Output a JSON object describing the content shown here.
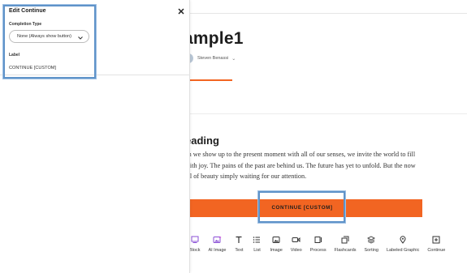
{
  "lesson": {
    "title": "ample1",
    "author": "Steven Benassi",
    "block_heading": "eading",
    "body_lines": [
      "en we show up to the present moment with all of our senses, we invite the world to fill",
      "with joy. The pains of the past are behind us. The future has yet to unfold. But the now",
      "all of beauty simply waiting for our attention."
    ],
    "continue_label": "CONTINUE [CUSTOM]"
  },
  "toolbar": {
    "items": [
      {
        "label": "Block",
        "icon": "block-icon"
      },
      {
        "label": "AI Image",
        "icon": "ai-image-icon"
      },
      {
        "label": "Text",
        "icon": "text-icon"
      },
      {
        "label": "List",
        "icon": "list-icon"
      },
      {
        "label": "Image",
        "icon": "image-icon"
      },
      {
        "label": "Video",
        "icon": "video-icon"
      },
      {
        "label": "Process",
        "icon": "process-icon"
      },
      {
        "label": "Flashcards",
        "icon": "flashcards-icon"
      },
      {
        "label": "Sorting",
        "icon": "sorting-icon"
      },
      {
        "label": "Labeled Graphic",
        "icon": "labeled-graphic-icon"
      },
      {
        "label": "Continue",
        "icon": "continue-icon"
      }
    ]
  },
  "panel": {
    "title": "Edit Continue",
    "completion_label": "Completion Type",
    "completion_value": "None (Always show button)",
    "label_caption": "Label",
    "label_value": "CONTINUE [CUSTOM]"
  },
  "colors": {
    "accent": "#f26522",
    "selection": "#5f93c9",
    "ai_purple": "#8a4fd6"
  }
}
